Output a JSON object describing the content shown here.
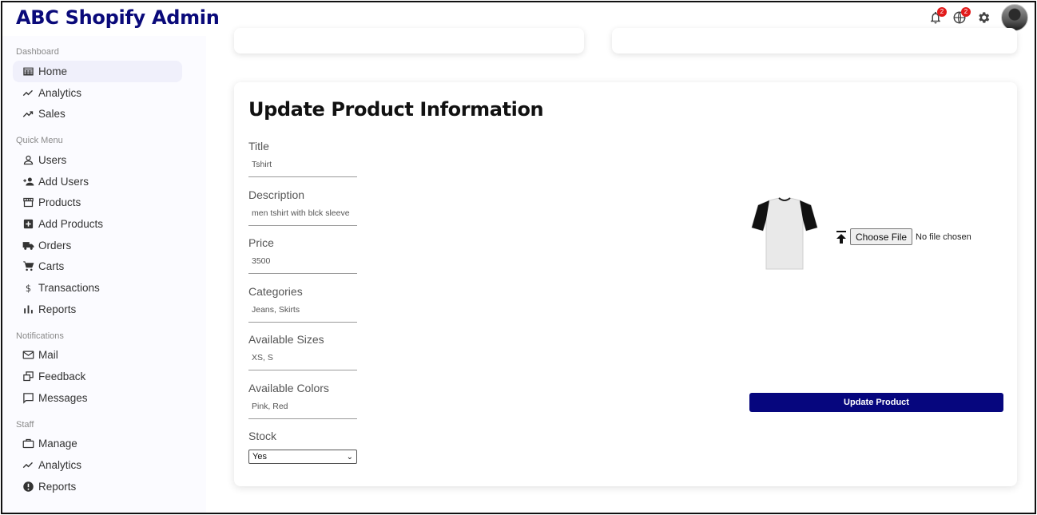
{
  "app": {
    "title": "ABC Shopify Admin"
  },
  "topbar": {
    "notifications_badge": "2",
    "language_badge": "2",
    "icons": [
      "bell-icon",
      "globe-icon",
      "gear-icon",
      "avatar"
    ]
  },
  "sidebar": {
    "sections": [
      {
        "title": "Dashboard",
        "items": [
          {
            "label": "Home",
            "icon": "table-icon",
            "active": true
          },
          {
            "label": "Analytics",
            "icon": "timeline-icon"
          },
          {
            "label": "Sales",
            "icon": "trending-up-icon"
          }
        ]
      },
      {
        "title": "Quick Menu",
        "items": [
          {
            "label": "Users",
            "icon": "person-icon"
          },
          {
            "label": "Add Users",
            "icon": "person-add-icon"
          },
          {
            "label": "Products",
            "icon": "storefront-icon"
          },
          {
            "label": "Add Products",
            "icon": "add-box-icon"
          },
          {
            "label": "Orders",
            "icon": "truck-icon"
          },
          {
            "label": "Carts",
            "icon": "cart-icon"
          },
          {
            "label": "Transactions",
            "icon": "dollar-icon"
          },
          {
            "label": "Reports",
            "icon": "bar-chart-icon"
          }
        ]
      },
      {
        "title": "Notifications",
        "items": [
          {
            "label": "Mail",
            "icon": "mail-icon"
          },
          {
            "label": "Feedback",
            "icon": "feedback-icon"
          },
          {
            "label": "Messages",
            "icon": "message-icon"
          }
        ]
      },
      {
        "title": "Staff",
        "items": [
          {
            "label": "Manage",
            "icon": "briefcase-icon"
          },
          {
            "label": "Analytics",
            "icon": "timeline-icon"
          },
          {
            "label": "Reports",
            "icon": "alert-circle-icon"
          }
        ]
      }
    ]
  },
  "form": {
    "title": "Update Product Information",
    "fields": [
      {
        "label": "Title",
        "value": "Tshirt"
      },
      {
        "label": "Description",
        "value": "men tshirt with blck sleeve"
      },
      {
        "label": "Price",
        "value": "3500"
      },
      {
        "label": "Categories",
        "value": "Jeans, Skirts"
      },
      {
        "label": "Available Sizes",
        "value": "XS, S"
      },
      {
        "label": "Available Colors",
        "value": "Pink, Red"
      }
    ],
    "stock": {
      "label": "Stock",
      "selected": "Yes"
    },
    "upload": {
      "button_label": "Choose File",
      "status": "No file chosen"
    },
    "submit_label": "Update Product"
  },
  "colors": {
    "brand": "#0a0a7a",
    "button": "#06067e",
    "badge": "#e21b1b"
  }
}
